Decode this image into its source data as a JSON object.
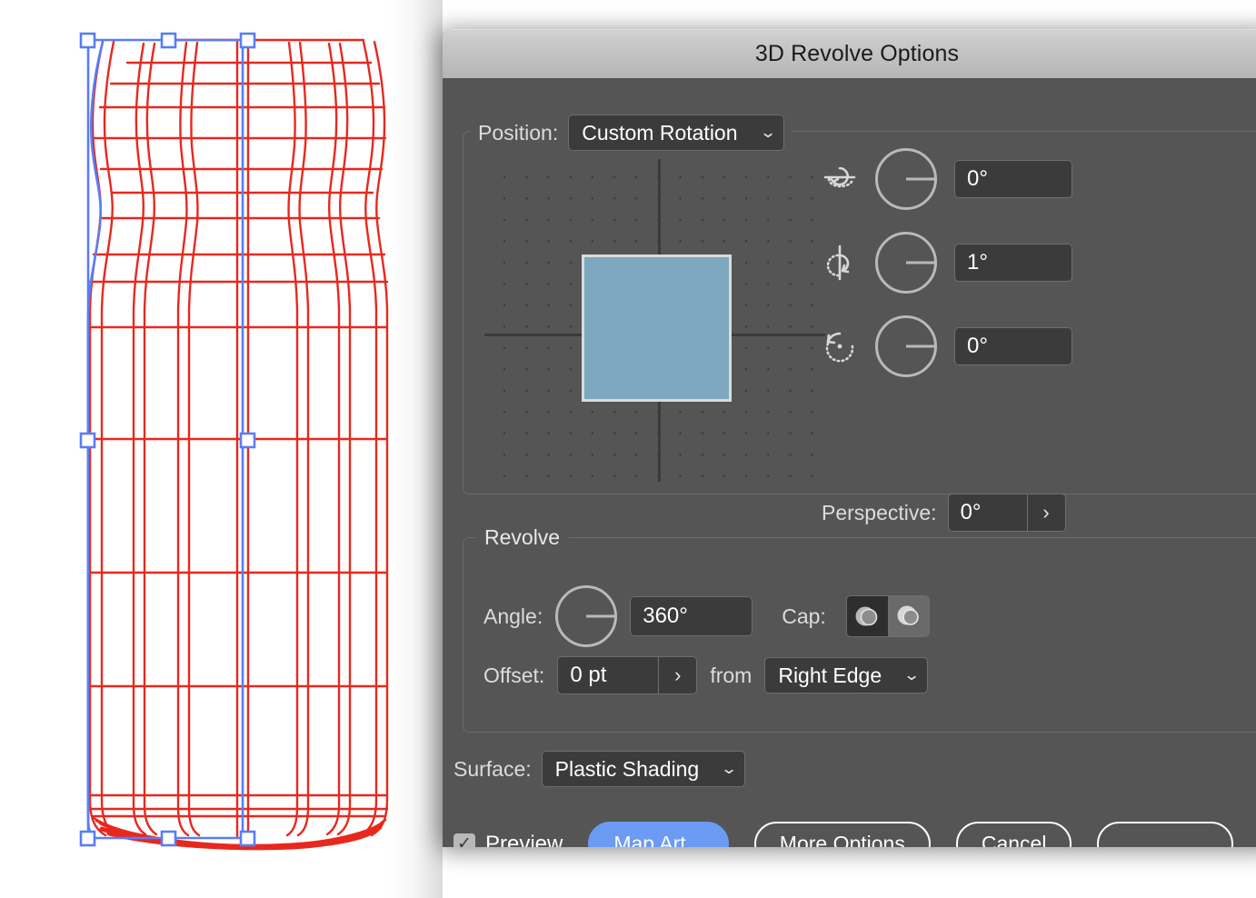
{
  "window": {
    "title": "3D Revolve Options"
  },
  "position": {
    "label": "Position:",
    "value": "Custom Rotation",
    "chevron_icon": "chevron-down-icon",
    "group_name": "position-group"
  },
  "rotation": {
    "rows": [
      {
        "axis": "x",
        "icon": "rotate-x-axis-icon",
        "value": "0°"
      },
      {
        "axis": "y",
        "icon": "rotate-y-axis-icon",
        "value": "1°"
      },
      {
        "axis": "z",
        "icon": "rotate-z-axis-icon",
        "value": "0°"
      }
    ]
  },
  "perspective": {
    "label": "Perspective:",
    "value": "0°",
    "arrow_icon": "chevron-right-icon"
  },
  "revolve": {
    "group_label": "Revolve",
    "angle_label": "Angle:",
    "angle_value": "360°",
    "cap_label": "Cap:",
    "cap_solid_icon": "cap-solid-icon",
    "cap_hollow_icon": "cap-hollow-icon",
    "cap_selected": "solid",
    "offset_label": "Offset:",
    "offset_value": "0 pt",
    "offset_arrow_icon": "chevron-right-icon",
    "from_label": "from",
    "from_value": "Right Edge",
    "from_chevron_icon": "chevron-down-icon"
  },
  "surface": {
    "label": "Surface:",
    "value": "Plastic Shading",
    "chevron_icon": "chevron-down-icon"
  },
  "footer": {
    "preview_label": "Preview",
    "preview_checked": true,
    "check_icon": "✓",
    "map_art_label": "Map Art...",
    "more_options_label": "More Options",
    "cancel_label": "Cancel",
    "ok_label": ""
  },
  "colors": {
    "dialog_bg": "#555555",
    "titlebar": "#c6c6c6",
    "accent_blue": "#6b9bf2",
    "field_bg": "#3b3b3b",
    "preview_face": "#7da8bf",
    "artwork_wireframe": "#e8281e",
    "artwork_selection": "#5a7df5"
  },
  "artwork": {
    "name": "3d-revolve-wireframe-preview",
    "description": "Red wireframe revolve preview of a bottle with blue selection bounding box and handles"
  }
}
